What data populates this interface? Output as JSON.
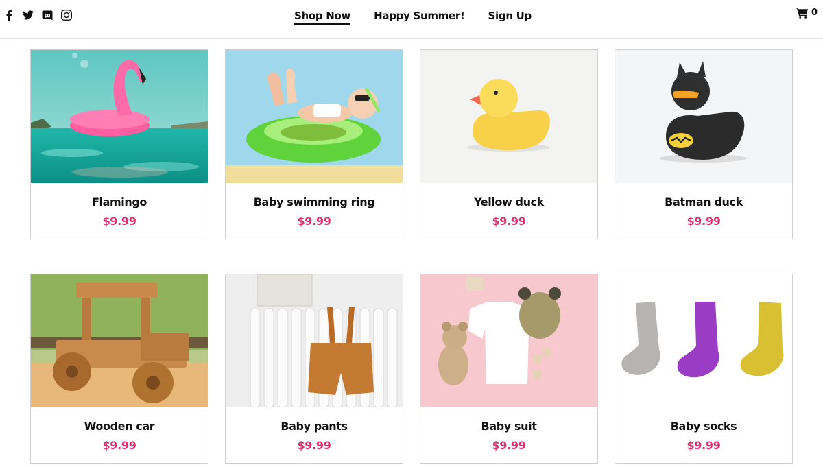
{
  "header": {
    "social": [
      {
        "icon": "facebook-icon"
      },
      {
        "icon": "twitter-icon"
      },
      {
        "icon": "discord-icon"
      },
      {
        "icon": "instagram-icon"
      }
    ],
    "nav": [
      {
        "label": "Shop Now",
        "active": true
      },
      {
        "label": "Happy Summer!"
      },
      {
        "label": "Sign Up"
      }
    ],
    "cart": {
      "icon": "cart-icon",
      "count": "0"
    }
  },
  "colors": {
    "price": "#e0306f",
    "text": "#111111",
    "border": "#cfcfcf"
  },
  "products": [
    {
      "name": "Flamingo",
      "price": "$9.99",
      "image": "pink flamingo pool float on turquoise water"
    },
    {
      "name": "Baby swimming ring",
      "price": "$9.99",
      "image": "baby in sunglasses lying in green swim ring"
    },
    {
      "name": "Yellow duck",
      "price": "$9.99",
      "image": "yellow rubber duck on white"
    },
    {
      "name": "Batman duck",
      "price": "$9.99",
      "image": "black batman rubber duck on white"
    },
    {
      "name": "Wooden car",
      "price": "$9.99",
      "image": "wooden toy truck near window"
    },
    {
      "name": "Baby pants",
      "price": "$9.99",
      "image": "brown baby overalls hanging on radiator"
    },
    {
      "name": "Baby suit",
      "price": "$9.99",
      "image": "white baby t-shirt with teddy bear on pink"
    },
    {
      "name": "Baby socks",
      "price": "$9.99",
      "image": "grey, purple and yellow knitted socks"
    }
  ]
}
